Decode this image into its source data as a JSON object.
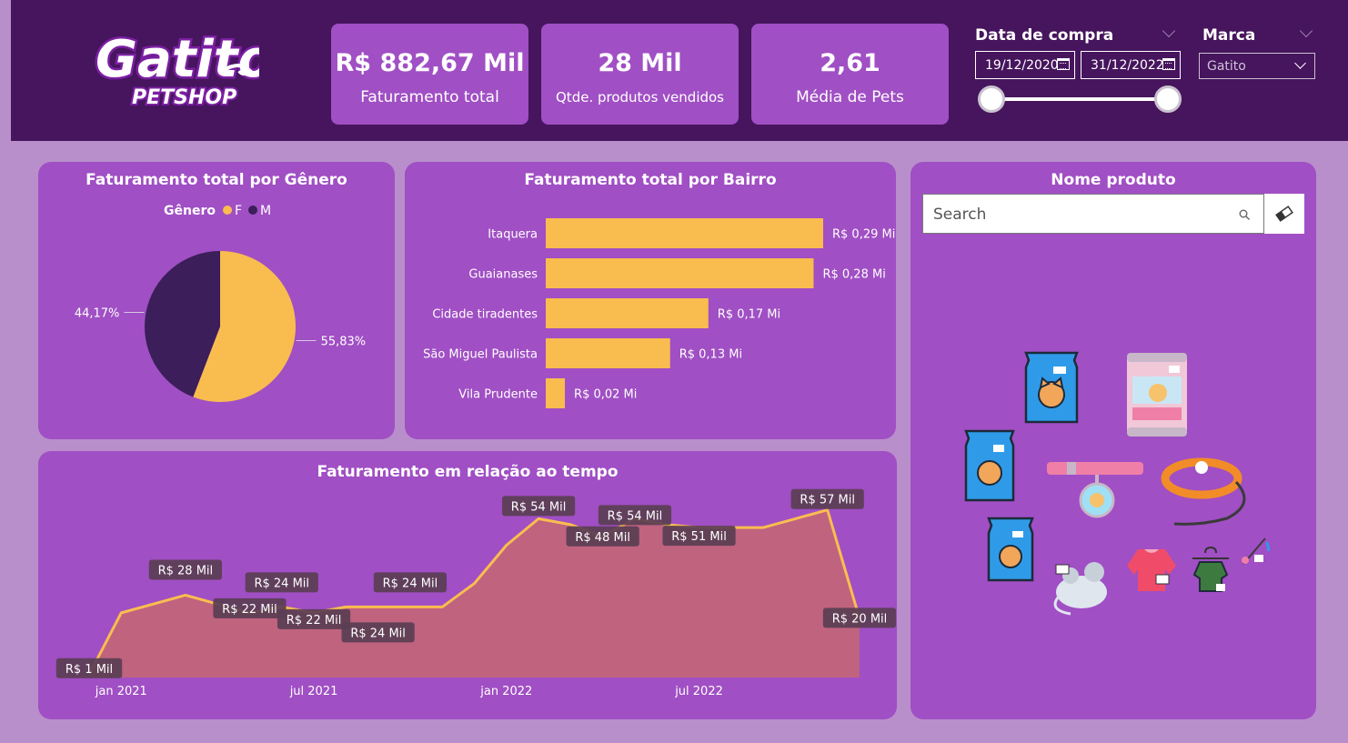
{
  "logo": {
    "line1": "Gatito",
    "line2": "PETSHOP"
  },
  "kpis": [
    {
      "value": "R$ 882,67 Mil",
      "label": "Faturamento total"
    },
    {
      "value": "28 Mil",
      "label": "Qtde. produtos vendidos"
    },
    {
      "value": "2,61",
      "label": "Média de Pets"
    }
  ],
  "filters": {
    "date": {
      "title": "Data de compra",
      "start": "19/12/2020",
      "end": "31/12/2022"
    },
    "brand": {
      "title": "Marca",
      "selected": "Gatito"
    }
  },
  "product_panel": {
    "title": "Nome produto",
    "search_placeholder": "Search"
  },
  "colors": {
    "header": "#46155d",
    "panel": "#a04fc4",
    "accent": "#f9bd4f",
    "dark_series": "#3b1e5a",
    "background": "#b98fcb"
  },
  "icons": [
    "gatito-logo",
    "calendar-icon",
    "chevron-down-icon",
    "search-icon",
    "eraser-icon",
    "cat-food-bag-icon",
    "cat-food-can-icon",
    "collar-with-tag-icon",
    "leash-icon",
    "toy-mouse-icon",
    "pet-jacket-icon",
    "pet-sweater-icon",
    "feather-wand-icon"
  ],
  "chart_data": [
    {
      "type": "pie",
      "title": "Faturamento total por Gênero",
      "legend_title": "Gênero",
      "legend_placement": "top",
      "slices": [
        {
          "name": "F",
          "value": 55.83,
          "label": "55,83%",
          "color": "#f9bd4f"
        },
        {
          "name": "M",
          "value": 44.17,
          "label": "44,17%",
          "color": "#3b1e5a"
        }
      ]
    },
    {
      "type": "bar",
      "orientation": "horizontal",
      "title": "Faturamento total por Bairro",
      "categories": [
        "Itaquera",
        "Guaianases",
        "Cidade tiradentes",
        "São Miguel Paulista",
        "Vila Prudente"
      ],
      "values": [
        0.29,
        0.28,
        0.17,
        0.13,
        0.02
      ],
      "labels": [
        "R$ 0,29 Mi",
        "R$ 0,28 Mi",
        "R$ 0,17 Mi",
        "R$ 0,13 Mi",
        "R$ 0,02 Mi"
      ],
      "color": "#f9bd4f",
      "xlim": [
        0,
        0.29
      ]
    },
    {
      "type": "area",
      "title": "Faturamento em relação ao tempo",
      "x_ticks": [
        "jan 2021",
        "jul 2021",
        "jan 2022",
        "jul 2022"
      ],
      "x": [
        "2020-12",
        "2021-01",
        "2021-02",
        "2021-03",
        "2021-04",
        "2021-05",
        "2021-06",
        "2021-07",
        "2021-08",
        "2021-09",
        "2021-10",
        "2021-11",
        "2021-12",
        "2022-01",
        "2022-02",
        "2022-03",
        "2022-04",
        "2022-05",
        "2022-06",
        "2022-07",
        "2022-08",
        "2022-09",
        "2022-10",
        "2022-11",
        "2022-12"
      ],
      "values": [
        1,
        22,
        25,
        28,
        25,
        22,
        24,
        22,
        24,
        24,
        24,
        24,
        32,
        45,
        54,
        52,
        48,
        54,
        52,
        51,
        51,
        51,
        54,
        57,
        20
      ],
      "data_labels": [
        {
          "index": 0,
          "text": "R$ 1 Mil"
        },
        {
          "index": 3,
          "text": "R$ 28 Mil"
        },
        {
          "index": 5,
          "text": "R$ 22 Mil"
        },
        {
          "index": 6,
          "text": "R$ 24 Mil"
        },
        {
          "index": 7,
          "text": "R$ 22 Mil"
        },
        {
          "index": 9,
          "text": "R$ 24 Mil"
        },
        {
          "index": 10,
          "text": "R$ 24 Mil"
        },
        {
          "index": 14,
          "text": "R$ 54 Mil"
        },
        {
          "index": 16,
          "text": "R$ 48 Mil"
        },
        {
          "index": 17,
          "text": "R$ 54 Mil"
        },
        {
          "index": 19,
          "text": "R$ 51 Mil"
        },
        {
          "index": 23,
          "text": "R$ 57 Mil"
        },
        {
          "index": 24,
          "text": "R$ 20 Mil"
        }
      ],
      "line_color": "#f9bd4f",
      "fill_color": "#c0637f",
      "ylim": [
        0,
        60
      ]
    }
  ]
}
